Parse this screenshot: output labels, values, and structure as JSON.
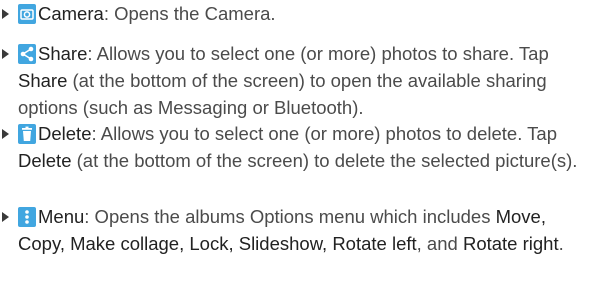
{
  "colors": {
    "icon_blue": "#41a6e0",
    "text": "#4b4b4b",
    "bullet": "#3a3a3a"
  },
  "items": [
    {
      "icon": "camera-icon",
      "term": "Camera",
      "desc": ": Opens the Camera."
    },
    {
      "icon": "share-icon",
      "term": "Share",
      "desc_1": ": Allows you to select one (or more) photos to share. Tap ",
      "term_2": "Share",
      "desc_2": " (at the bottom of the screen) to open the available sharing options (such as Messaging or Bluetooth)."
    },
    {
      "icon": "trash-icon",
      "term": "Delete",
      "desc_1": ": Allows you to select one (or more) photos to delete. Tap ",
      "term_2": "Delete",
      "desc_2": " (at the bottom of the screen) to delete the selected picture(s)."
    },
    {
      "icon": "menu-icon",
      "term": "Menu",
      "desc_1": ": Opens the albums Options menu which includes ",
      "term_2": "Move, Copy, Make collage, Lock, Slideshow, Rotate left",
      "desc_2": ", and ",
      "term_3": "Rotate right",
      "desc_3": "."
    }
  ]
}
